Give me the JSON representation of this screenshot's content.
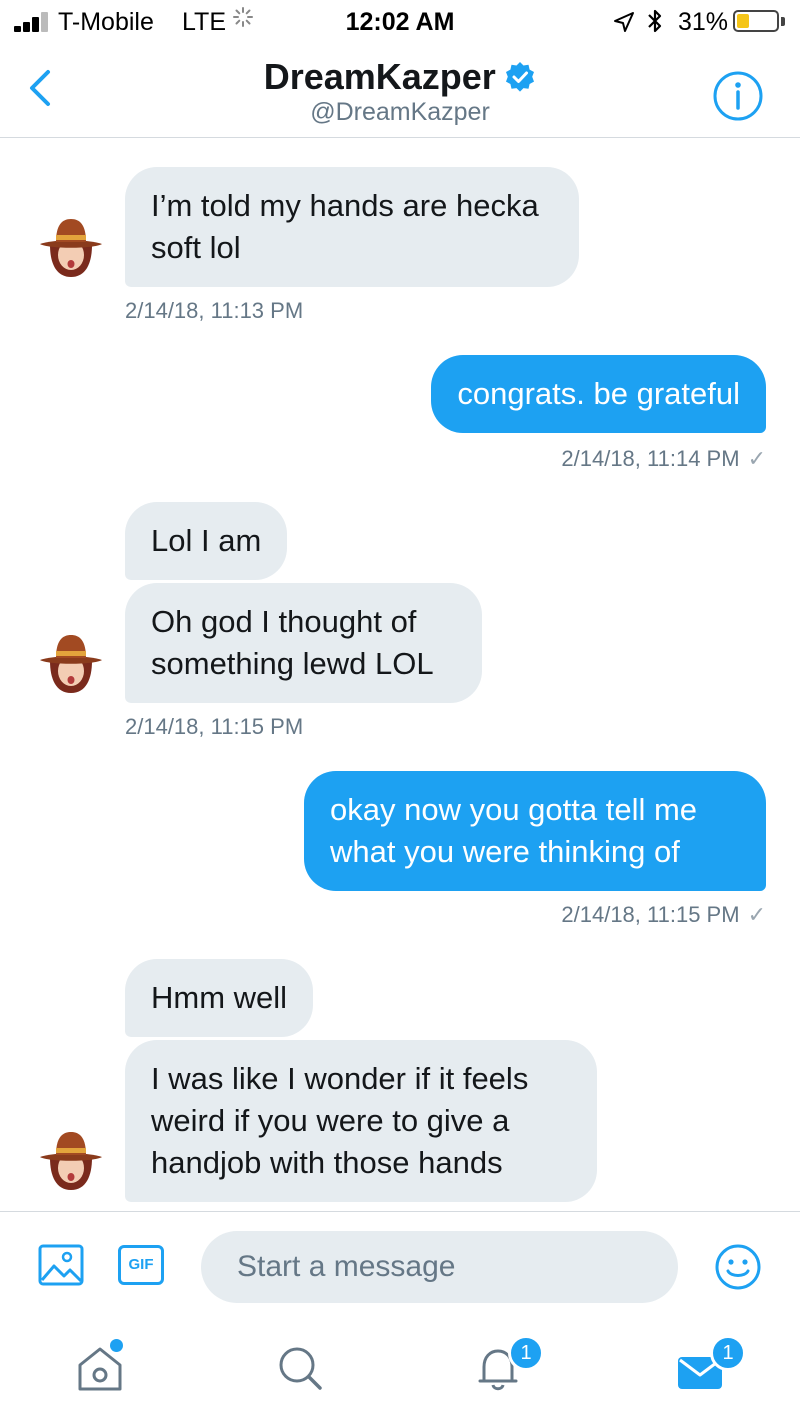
{
  "status_bar": {
    "carrier": "T-Mobile",
    "network": "LTE",
    "time": "12:02 AM",
    "battery_percent": "31%",
    "battery_level": 0.31
  },
  "header": {
    "name": "DreamKazper",
    "handle": "@DreamKazper",
    "verified": true
  },
  "messages": [
    {
      "from": "them",
      "text": "I’m told my hands are hecka soft lol"
    },
    {
      "from": "them",
      "timestamp": "2/14/18, 11:13 PM"
    },
    {
      "from": "me",
      "text": "congrats. be grateful"
    },
    {
      "from": "me",
      "timestamp": "2/14/18, 11:14 PM"
    },
    {
      "from": "them",
      "text": "Lol I am"
    },
    {
      "from": "them",
      "text": "Oh god I thought of something lewd LOL"
    },
    {
      "from": "them",
      "timestamp": "2/14/18, 11:15 PM"
    },
    {
      "from": "me",
      "text": "okay now you gotta tell me what you were thinking of"
    },
    {
      "from": "me",
      "timestamp": "2/14/18, 11:15 PM"
    },
    {
      "from": "them",
      "text": "Hmm well"
    },
    {
      "from": "them",
      "text": "I was like I wonder if it feels weird if you were to give a handjob with those hands"
    }
  ],
  "composer": {
    "gif_label": "GIF",
    "placeholder": "Start a message"
  },
  "tabbar": {
    "notifications_badge": "1",
    "messages_badge": "1"
  },
  "colors": {
    "accent": "#1da1f2",
    "incoming_bubble": "#e6ecf0",
    "secondary_text": "#657786"
  },
  "icons": [
    "back-chevron-icon",
    "verified-badge-icon",
    "info-icon",
    "image-icon",
    "smiley-icon",
    "home-icon",
    "search-icon",
    "bell-icon",
    "envelope-icon"
  ]
}
